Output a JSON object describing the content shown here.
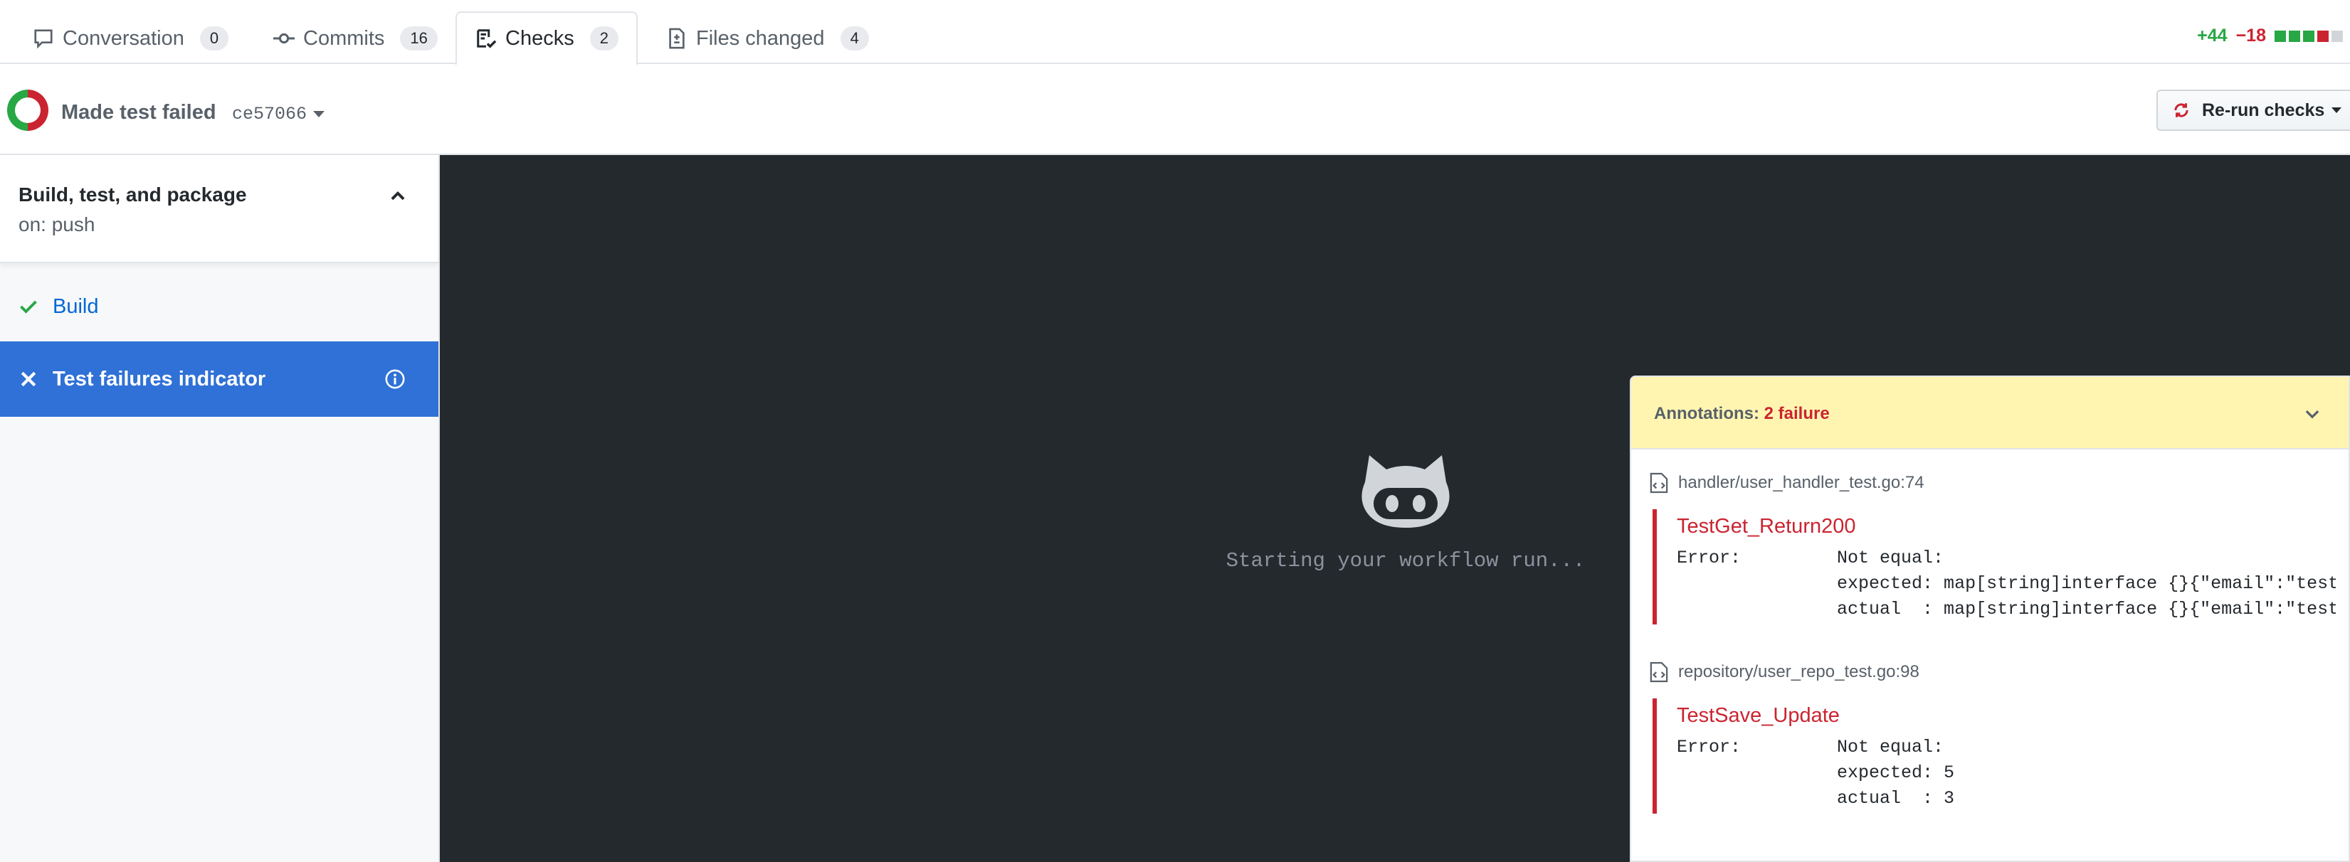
{
  "tabs": [
    {
      "label": "Conversation",
      "count": "0",
      "icon": "comment-icon"
    },
    {
      "label": "Commits",
      "count": "16",
      "icon": "commit-icon"
    },
    {
      "label": "Checks",
      "count": "2",
      "icon": "checklist-icon"
    },
    {
      "label": "Files changed",
      "count": "4",
      "icon": "file-diff-icon"
    }
  ],
  "diffstat": {
    "additions": "+44",
    "deletions": "−18"
  },
  "commit": {
    "title": "Made test failed",
    "sha": "ce57066"
  },
  "rerun": {
    "label": "Re-run checks"
  },
  "workflow": {
    "name": "Build, test, and package",
    "trigger": "on: push",
    "jobs": [
      {
        "label": "Build",
        "status": "success"
      },
      {
        "label": "Test failures indicator",
        "status": "failure"
      }
    ]
  },
  "log": {
    "status_text": "Starting your workflow run..."
  },
  "annotations": {
    "label": "Annotations:",
    "count_text": "2 failure",
    "items": [
      {
        "file": "handler/user_handler_test.go:74",
        "title": "TestGet_Return200",
        "message": "Error:         Not equal:\n               expected: map[string]interface {}{\"email\":\"test@example.com\"\n               actual  : map[string]interface {}{\"email\":\"test@example.com\""
      },
      {
        "file": "repository/user_repo_test.go:98",
        "title": "TestSave_Update",
        "message": "Error:         Not equal:\n               expected: 5\n               actual  : 3"
      }
    ]
  },
  "colors": {
    "success": "#28a745",
    "failure": "#cb2431",
    "selected": "#2f71d6",
    "log_bg": "#24292e",
    "annotation_bg": "#fff5b1"
  }
}
